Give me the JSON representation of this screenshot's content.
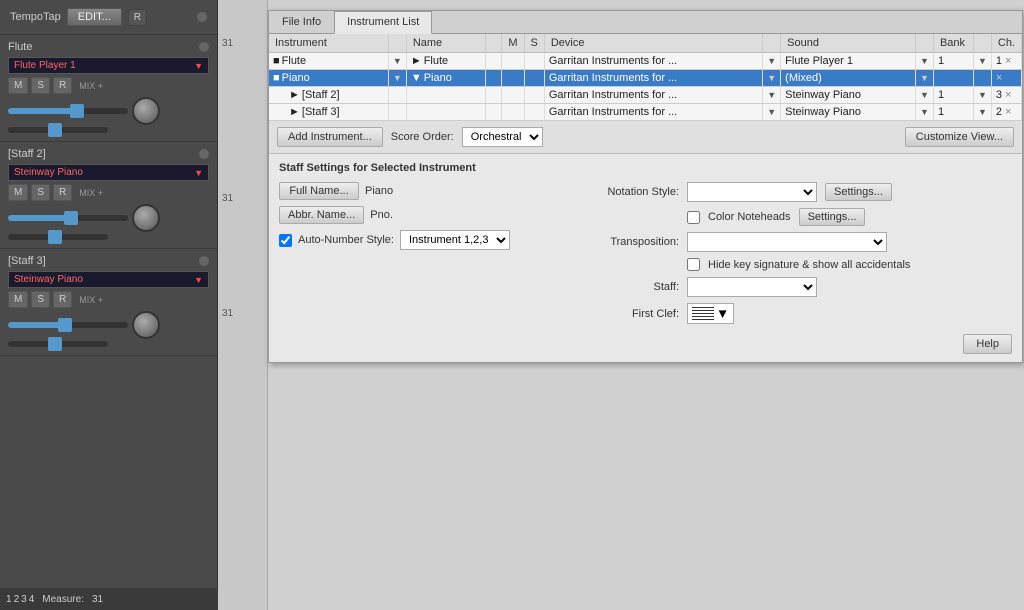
{
  "leftPanel": {
    "tempo": {
      "label": "TempoTap",
      "editBtn": "EDIT...",
      "rBtn": "R"
    },
    "channels": [
      {
        "name": "Flute",
        "sound": "Flute Player 1",
        "controls": [
          "M",
          "S",
          "R"
        ],
        "mixLabel": "MIX +"
      },
      {
        "name": "[Staff 2]",
        "sound": "Steinway Piano",
        "controls": [
          "M",
          "S",
          "R"
        ],
        "mixLabel": "MIX +"
      },
      {
        "name": "[Staff 3]",
        "sound": "Steinway Piano",
        "controls": [
          "M",
          "S",
          "R"
        ],
        "mixLabel": "MIX +"
      }
    ]
  },
  "statusBar": {
    "tabs": [
      "1",
      "2",
      "3",
      "4"
    ],
    "measureLabel": "Measure:",
    "measureVal": "31"
  },
  "dialog": {
    "tabs": [
      "File Info",
      "Instrument List"
    ],
    "activeTab": "Instrument List",
    "table": {
      "headers": [
        "Instrument",
        "",
        "Name",
        "",
        "M",
        "S",
        "Device",
        "",
        "Sound",
        "",
        "Bank",
        "",
        "Ch."
      ],
      "rows": [
        {
          "instrument": "Flute",
          "name": "Flute",
          "device": "Garritan Instruments for ...",
          "sound": "Flute Player 1",
          "bank": "1",
          "ch": "1",
          "selected": false,
          "indent": 0
        },
        {
          "instrument": "Piano",
          "name": "Piano",
          "device": "Garritan Instruments for ...",
          "sound": "(Mixed)",
          "bank": "",
          "ch": "",
          "selected": true,
          "indent": 0
        },
        {
          "instrument": "[Staff 2]",
          "name": "",
          "device": "Garritan Instruments for ...",
          "sound": "Steinway Piano",
          "bank": "1",
          "ch": "3",
          "selected": false,
          "indent": 1
        },
        {
          "instrument": "[Staff 3]",
          "name": "",
          "device": "Garritan Instruments for ...",
          "sound": "Steinway Piano",
          "bank": "1",
          "ch": "2",
          "selected": false,
          "indent": 1
        }
      ]
    },
    "toolbar": {
      "addBtn": "Add Instrument...",
      "scoreOrderLabel": "Score Order:",
      "scoreOrderValue": "Orchestral",
      "customizeBtn": "Customize View..."
    },
    "staffSettings": {
      "title": "Staff Settings for Selected Instrument",
      "fullNameBtn": "Full Name...",
      "fullNameVal": "Piano",
      "abbrNameBtn": "Abbr. Name...",
      "abbrNameVal": "Pno.",
      "autoNumberCheckbox": true,
      "autoNumberLabel": "Auto-Number Style:",
      "autoNumberValue": "Instrument 1,2,3",
      "notationStyleLabel": "Notation Style:",
      "notationStyleBtn": "Settings...",
      "colorNoteheads": "Color Noteheads",
      "colorNoteheadsBtn": "Settings...",
      "transpositionLabel": "Transposition:",
      "hideKeyLabel": "Hide key signature & show all accidentals",
      "staffLabel": "Staff:",
      "firstClefLabel": "First Clef:",
      "helpBtn": "Help"
    }
  },
  "measures": [
    "31",
    "31",
    "31"
  ]
}
